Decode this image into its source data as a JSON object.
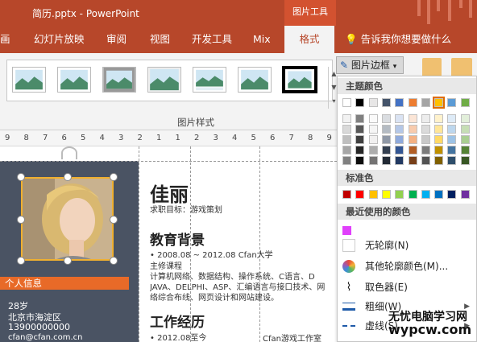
{
  "window": {
    "title": "简历.pptx - PowerPoint",
    "context_tools": "图片工具"
  },
  "tabs": [
    {
      "label": "画"
    },
    {
      "label": "幻灯片放映"
    },
    {
      "label": "审阅"
    },
    {
      "label": "视图"
    },
    {
      "label": "开发工具"
    },
    {
      "label": "Mix"
    },
    {
      "label": "格式",
      "active": true
    }
  ],
  "tell_me": "告诉我你想要做什么",
  "ribbon": {
    "group_label": "图片样式",
    "border_button": "图片边框"
  },
  "ruler": [
    "9",
    "8",
    "7",
    "6",
    "5",
    "4",
    "3",
    "2",
    "1",
    "1",
    "2",
    "3",
    "4",
    "5",
    "6",
    "7",
    "8",
    "9"
  ],
  "sidebar": {
    "info_title": "个人信息",
    "lines": [
      "28岁",
      "北京市海淀区",
      "13900000000",
      "cfan@cfan.com.cn"
    ]
  },
  "resume": {
    "name": "佳丽",
    "objective": "求职目标：游戏策划",
    "edu_heading": "教育背景",
    "edu_lines": [
      "•  2008.08 ~ 2012.08 Cfan大学",
      "主修课程",
      "计算机网络、数据结构、操作系统、C语言、D",
      "JAVA、DELPHI、ASP、汇编语言与接口技术、网",
      "络综合布线、网页设计和网站建设。"
    ],
    "work_heading": "工作经历",
    "work_line": "•  2012.08至今",
    "work_company": "Cfan游戏工作室"
  },
  "menu": {
    "theme_header": "主题颜色",
    "standard_header": "标准色",
    "recent_header": "最近使用的颜色",
    "items": [
      {
        "label": "无轮廓(N)"
      },
      {
        "label": "其他轮廓颜色(M)..."
      },
      {
        "label": "取色器(E)"
      },
      {
        "label": "粗细(W)",
        "submenu": true
      },
      {
        "label": "虚线(S)",
        "submenu": true
      }
    ],
    "theme_top": [
      "#ffffff",
      "#000000",
      "#e7e6e6",
      "#44546a",
      "#4472c4",
      "#ed7d31",
      "#a5a5a5",
      "#ffc000",
      "#5b9bd5",
      "#70ad47"
    ],
    "standard": [
      "#c00000",
      "#ff0000",
      "#ffc000",
      "#ffff00",
      "#92d050",
      "#00b050",
      "#00b0f0",
      "#0070c0",
      "#002060",
      "#7030a0"
    ],
    "recent": [
      "#e040fb"
    ]
  },
  "watermark": {
    "line1": "无忧电脑学习网",
    "line2": "wypcw.com"
  }
}
